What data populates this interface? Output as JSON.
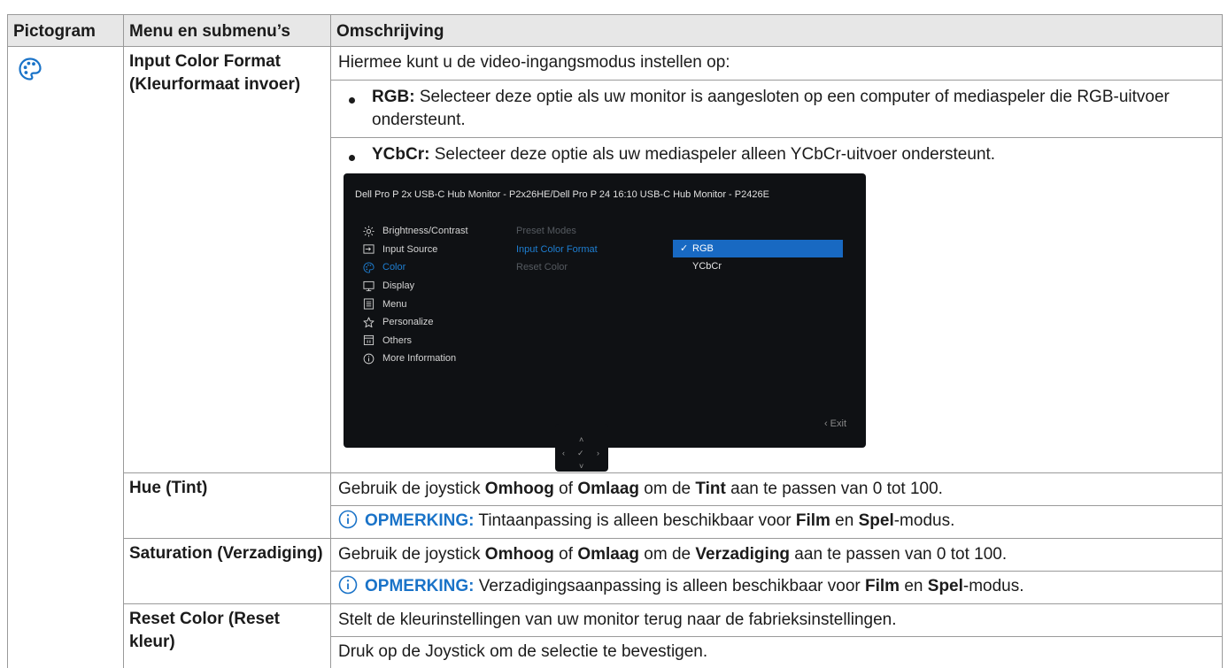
{
  "table": {
    "headers": [
      "Pictogram",
      "Menu en submenu’s",
      "Omschrijving"
    ],
    "pictogram_icon": "color-palette-icon",
    "rows": {
      "input_color": {
        "menu": "Input Color Format (Kleurformaat invoer)",
        "intro": "Hiermee kunt u de video-ingangsmodus instellen op:",
        "options": [
          {
            "term": "RGB:",
            "text": " Selecteer deze optie als uw monitor is aangesloten op een computer of mediaspeler die RGB-uitvoer ondersteunt."
          },
          {
            "term": "YCbCr:",
            "text": " Selecteer deze optie als uw mediaspeler alleen YCbCr-uitvoer ondersteunt."
          }
        ]
      },
      "hue": {
        "menu": "Hue (Tint)",
        "d1": "Gebruik de joystick ",
        "d2": "Omhoog",
        "d3": " of ",
        "d4": "Omlaag",
        "d5": " om de ",
        "d6": "Tint",
        "d7": " aan te passen van 0 tot 100.",
        "note_label": "OPMERKING:",
        "n1": " Tintaanpassing is alleen beschikbaar voor ",
        "n2": "Film",
        "n3": " en ",
        "n4": "Spel",
        "n5": "-modus."
      },
      "saturation": {
        "menu": "Saturation (Verzadiging)",
        "d1": "Gebruik de joystick ",
        "d2": "Omhoog",
        "d3": " of ",
        "d4": "Omlaag",
        "d5": " om de ",
        "d6": "Verzadiging",
        "d7": " aan te passen van 0 tot 100.",
        "note_label": "OPMERKING:",
        "n1": " Verzadigingsaanpassing is alleen beschikbaar voor ",
        "n2": "Film",
        "n3": " en ",
        "n4": "Spel",
        "n5": "-modus."
      },
      "reset": {
        "menu": "Reset Color (Reset kleur)",
        "line1": "Stelt de kleurinstellingen van uw monitor terug naar de fabrieksinstellingen.",
        "line2": "Druk op de Joystick om de selectie te bevestigen."
      }
    }
  },
  "osd": {
    "title": "Dell Pro P 2x USB-C Hub Monitor - P2x26HE/Dell Pro P 24 16:10 USB-C Hub Monitor - P2426E",
    "menu": [
      {
        "label": "Brightness/Contrast",
        "icon": "brightness-icon"
      },
      {
        "label": "Input Source",
        "icon": "input-source-icon"
      },
      {
        "label": "Color",
        "icon": "color-palette-icon"
      },
      {
        "label": "Display",
        "icon": "display-icon"
      },
      {
        "label": "Menu",
        "icon": "menu-icon"
      },
      {
        "label": "Personalize",
        "icon": "star-icon"
      },
      {
        "label": "Others",
        "icon": "others-icon"
      },
      {
        "label": "More Information",
        "icon": "info-icon"
      }
    ],
    "active_menu": "Color",
    "submenu": [
      "Preset Modes",
      "Input Color Format",
      "Reset Color"
    ],
    "selected_submenu": "Input Color Format",
    "options": [
      "RGB",
      "YCbCr"
    ],
    "selected_option": "RGB",
    "exit": "‹ Exit",
    "joystick": {
      "up": "˄",
      "down": "˅",
      "left": "‹",
      "right": "›",
      "center": "✓"
    }
  },
  "colors": {
    "note_blue": "#1a73c8",
    "osd_blue": "#1e7ed1",
    "osd_bg": "#0f1114",
    "header_bg": "#e7e7e7"
  }
}
